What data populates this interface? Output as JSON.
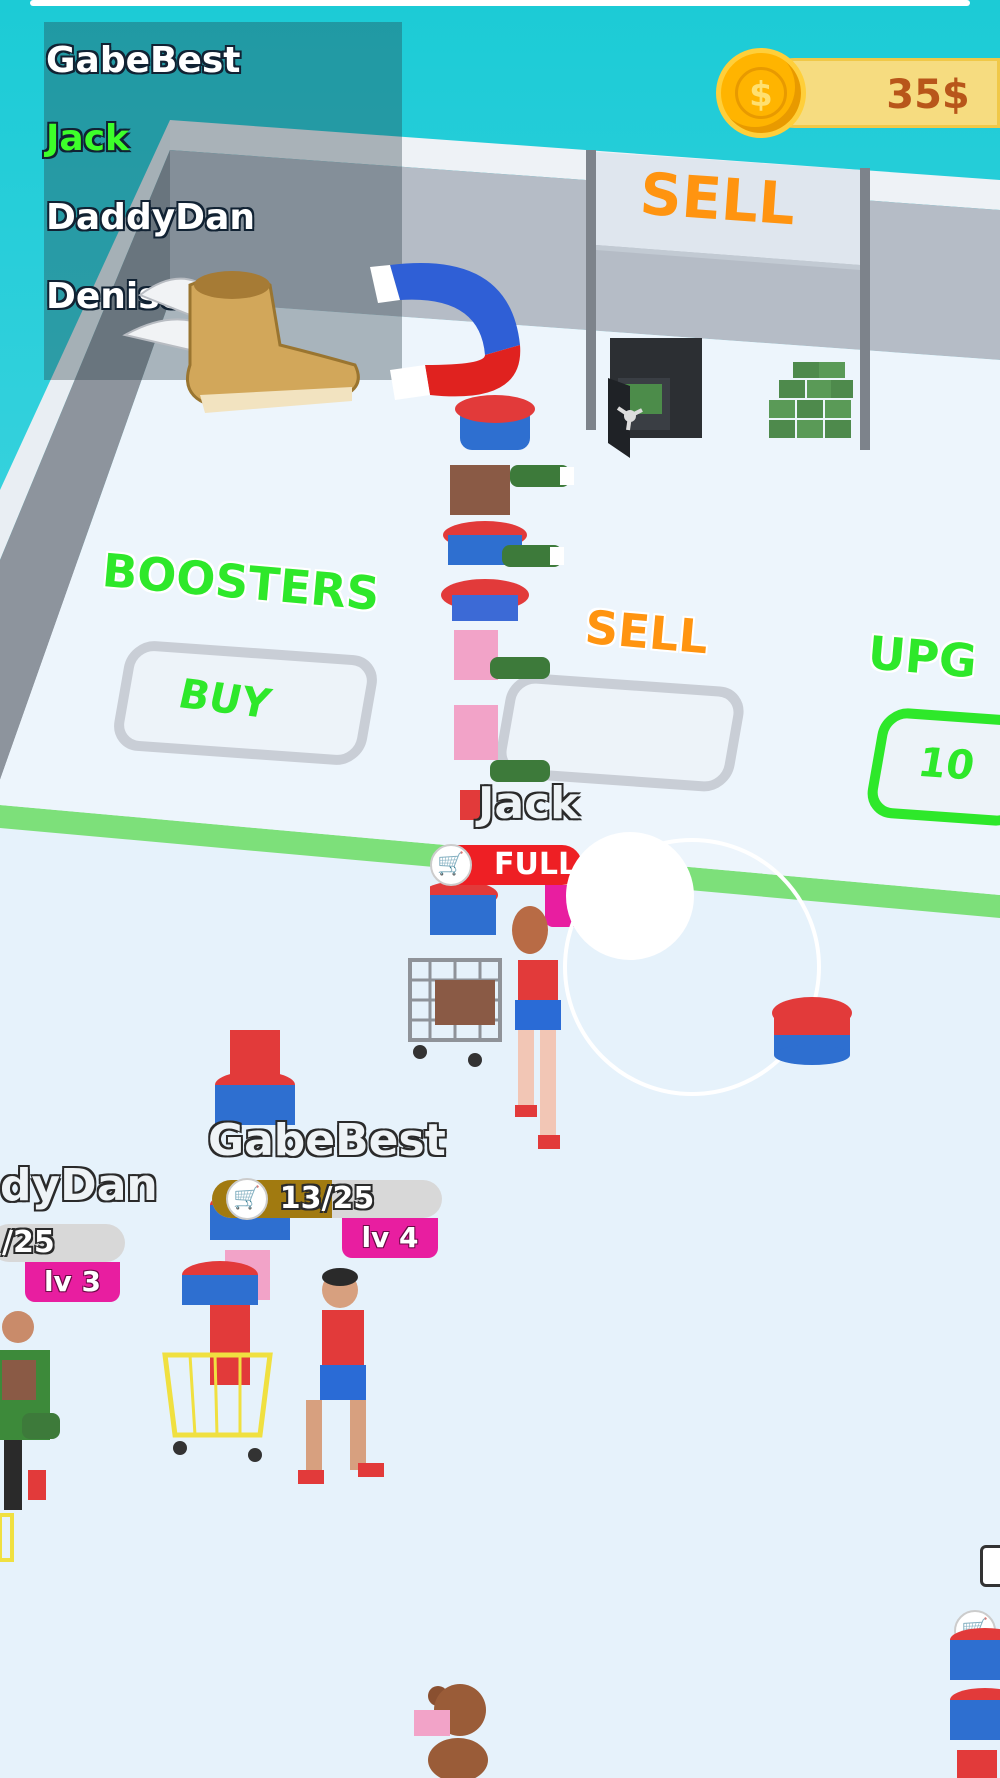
{
  "leaderboard": [
    {
      "name": "GabeBest",
      "color": "#ffffff"
    },
    {
      "name": "Jack",
      "color": "#3dff2a"
    },
    {
      "name": "DaddyDan",
      "color": "#ffffff"
    },
    {
      "name": "Denise",
      "color": "#ffffff"
    }
  ],
  "currency": {
    "value": "35$",
    "icon": "dollar-coin-icon"
  },
  "sell_sign": {
    "label": "SELL"
  },
  "zones": {
    "boosters": {
      "title": "BOOSTERS",
      "pad_label": "BUY"
    },
    "sell": {
      "title": "SELL"
    },
    "upgrade": {
      "title": "UPG",
      "pad_label": "10"
    }
  },
  "players": {
    "jack": {
      "name": "Jack",
      "status": "FULL",
      "capacity_fraction": 1.0
    },
    "gabebest": {
      "name": "GabeBest",
      "capacity": "13/25",
      "capacity_fraction": 0.52,
      "level": "lv 4"
    },
    "daddydan": {
      "name": "dyDan",
      "capacity": "/25",
      "level": "lv 3"
    }
  },
  "colors": {
    "sky": "#19c8d4",
    "floor": "#e6f2fb",
    "zone_green": "#2ee82a",
    "sell_orange": "#ff9410",
    "full_red": "#ee1f24",
    "level_pink": "#e81ea0",
    "coin_gold": "#ffb400"
  }
}
